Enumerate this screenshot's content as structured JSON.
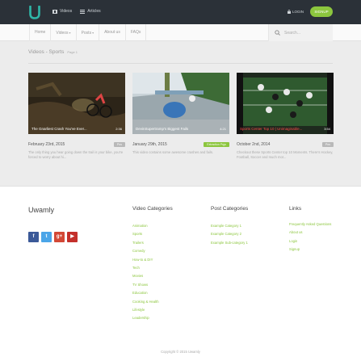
{
  "header": {
    "nav": [
      {
        "label": "Videos",
        "icon": "film-icon"
      },
      {
        "label": "Articles",
        "icon": "list-icon"
      }
    ],
    "login_label": "LOGIN",
    "signup_label": "SIGNUP",
    "accent_color": "#8cc63e"
  },
  "subnav": {
    "items": [
      {
        "label": "Home",
        "dropdown": false
      },
      {
        "label": "Videos",
        "dropdown": true
      },
      {
        "label": "Posts",
        "dropdown": true
      },
      {
        "label": "About us",
        "dropdown": false
      },
      {
        "label": "FAQs",
        "dropdown": false
      }
    ],
    "search_placeholder": "Search..."
  },
  "page": {
    "title": "Videos - Sports",
    "subtitle": "Page 1"
  },
  "cards": [
    {
      "caption": "The Gnarliest Crash You've Ever...",
      "time": "2:36",
      "date": "February 23rd, 2015",
      "badge": "Pos",
      "desc": "The only thing you hear going down the trail is your bike, you're forced to worry about hi..."
    },
    {
      "caption": "DevinSupertramp's Biggest Fails",
      "time": "4:21",
      "date": "January 29th, 2015",
      "badge": "Extraction Prgs",
      "desc": "This video contains some awesome crashes and fails."
    },
    {
      "caption": "Sports Center Top 10 | Unimaginable...",
      "time": "3:54",
      "date": "October 2nd, 2014",
      "badge": "Pos",
      "desc": "Checkout these Sports Center top 10 Moments. There's Hockey, Football, Soccer and much mor..."
    }
  ],
  "footer": {
    "brand": "Uwamly",
    "social": [
      {
        "label": "f",
        "icon": "facebook-icon"
      },
      {
        "label": "t",
        "icon": "twitter-icon"
      },
      {
        "label": "g+",
        "icon": "google-plus-icon"
      },
      {
        "label": "▶",
        "icon": "youtube-icon"
      }
    ],
    "video_categories": {
      "title": "Video Categories",
      "items": [
        "Animation",
        "Sports",
        "Trailers",
        "Comedy",
        "How-to & DIY",
        "Tech",
        "Movies",
        "TV Shows",
        "Education",
        "Cooking & Health",
        "Lifestyle",
        "Leadership"
      ]
    },
    "post_categories": {
      "title": "Post Categories",
      "items": [
        "Example Category 1",
        "Example Category 2",
        "Example Sub-category 1"
      ]
    },
    "links": {
      "title": "Links",
      "items": [
        "Frequently Asked Questions",
        "About us",
        "Login",
        "Signup"
      ]
    },
    "copyright": "Copyright © 2015 Uwamly"
  }
}
